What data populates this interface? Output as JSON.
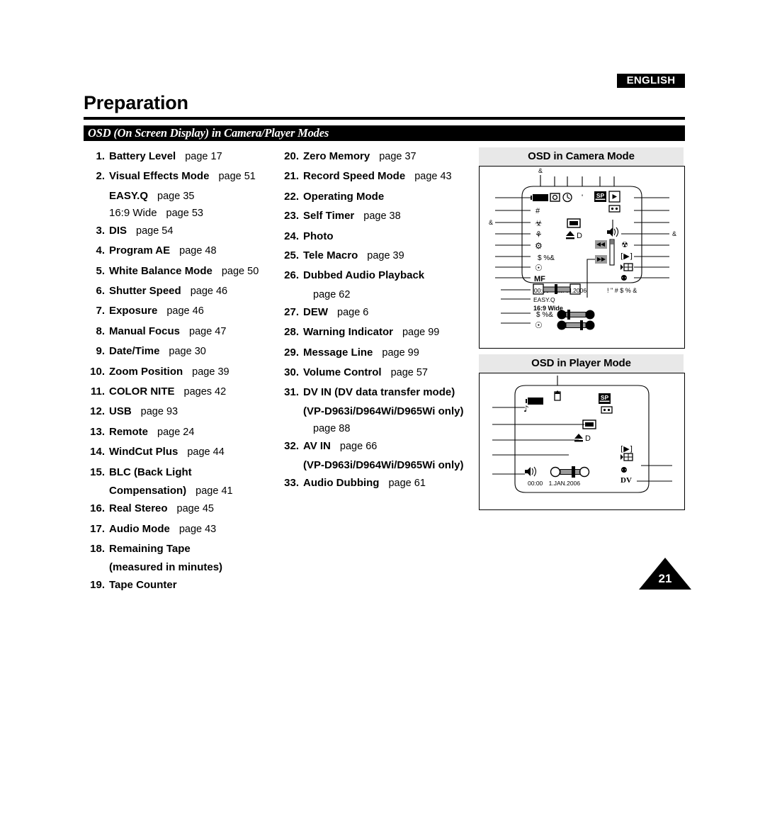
{
  "header": {
    "language_badge": "ENGLISH",
    "chapter_title": "Preparation",
    "section_title": "OSD (On Screen Display) in Camera/Player Modes"
  },
  "page_number": "21",
  "column1": [
    {
      "num": "1.",
      "label": "Battery Level",
      "page": "page 17"
    },
    {
      "num": "2.",
      "label": "Visual Effects Mode",
      "page": "page 51",
      "subs": [
        {
          "label": "EASY.Q",
          "page": "page 35",
          "bold": true
        },
        {
          "label": "16:9 Wide",
          "page": "page 53",
          "bold": false
        }
      ]
    },
    {
      "num": "3.",
      "label": "DIS",
      "page": "page 54"
    },
    {
      "num": "4.",
      "label": "Program AE",
      "page": "page 48"
    },
    {
      "num": "5.",
      "label": "White Balance Mode",
      "page": "page 50"
    },
    {
      "num": "6.",
      "label": "Shutter Speed",
      "page": "page 46"
    },
    {
      "num": "7.",
      "label": "Exposure",
      "page": "page 46"
    },
    {
      "num": "8.",
      "label": "Manual Focus",
      "page": "page 47"
    },
    {
      "num": "9.",
      "label": "Date/Time",
      "page": "page 30"
    },
    {
      "num": "10.",
      "label": "Zoom Position",
      "page": "page 39"
    },
    {
      "num": "11.",
      "label": "COLOR NITE",
      "page": "pages 42"
    },
    {
      "num": "12.",
      "label": "USB",
      "page": "page 93"
    },
    {
      "num": "13.",
      "label": "Remote",
      "page": "page 24"
    },
    {
      "num": "14.",
      "label": "WindCut Plus",
      "page": "page 44"
    },
    {
      "num": "15.",
      "label": "BLC (Back Light",
      "page": "",
      "subs": [
        {
          "label": "Compensation)",
          "page": "page 41",
          "bold": true
        }
      ]
    },
    {
      "num": "16.",
      "label": "Real Stereo",
      "page": "page 45"
    },
    {
      "num": "17.",
      "label": "Audio Mode",
      "page": "page 43"
    },
    {
      "num": "18.",
      "label": "Remaining Tape",
      "page": "",
      "subs": [
        {
          "label": "(measured in minutes)",
          "page": "",
          "bold": true
        }
      ]
    },
    {
      "num": "19.",
      "label": "Tape Counter",
      "page": ""
    }
  ],
  "column2": [
    {
      "num": "20.",
      "label": "Zero Memory",
      "page": "page 37"
    },
    {
      "num": "21.",
      "label": "Record Speed Mode",
      "page": "page 43"
    },
    {
      "num": "22.",
      "label": "Operating Mode",
      "page": ""
    },
    {
      "num": "23.",
      "label": "Self Timer",
      "page": "page 38"
    },
    {
      "num": "24.",
      "label": "Photo",
      "page": ""
    },
    {
      "num": "25.",
      "label": "Tele Macro",
      "page": "page 39"
    },
    {
      "num": "26.",
      "label": "Dubbed Audio Playback",
      "page": "",
      "subs2": [
        {
          "label": "",
          "page": "page 62"
        }
      ]
    },
    {
      "num": "27.",
      "label": "DEW",
      "page": "page 6"
    },
    {
      "num": "28.",
      "label": "Warning Indicator",
      "page": "page 99"
    },
    {
      "num": "29.",
      "label": "Message Line",
      "page": "page 99"
    },
    {
      "num": "30.",
      "label": "Volume Control",
      "page": "page 57"
    },
    {
      "num": "31.",
      "label": "DV IN (DV data transfer mode)",
      "page": "",
      "subs": [
        {
          "label": "(VP-D963i/D964Wi/D965Wi only)",
          "page": "",
          "bold": true
        }
      ],
      "subs2": [
        {
          "label": "",
          "page": "page 88"
        }
      ]
    },
    {
      "num": "32.",
      "label": "AV IN",
      "page": "page 66",
      "subs": [
        {
          "label": "(VP-D963i/D964Wi/D965Wi only)",
          "page": "",
          "bold": true
        }
      ]
    },
    {
      "num": "33.",
      "label": "Audio Dubbing",
      "page": "page 61"
    }
  ],
  "panels": {
    "camera": {
      "title": "OSD in Camera Mode",
      "timecode": "00:00",
      "date": "1.JAN.2006",
      "speed_badge": "SP",
      "easyq": "EASY.Q",
      "wide": "16:9 Wide",
      "dv_marker": "D",
      "warning_glyphs": "! \" #  $ %  &",
      "icons": [
        "battery-icon",
        "tele-macro-icon",
        "photo-icon",
        "self-timer-icon",
        "dis-icon",
        "program-ae-icon",
        "white-balance-icon",
        "shutter-speed-icon",
        "exposure-icon",
        "manual-focus-icon",
        "record-mode-icon",
        "play-icon",
        "tape-icon",
        "volume-icon",
        "rewind-icon",
        "fast-forward-icon",
        "zoom-bar-icon",
        "windcut-icon",
        "blc-icon",
        "real-stereo-icon",
        "audio-mode-icon",
        "colornite-icon",
        "usb-icon",
        "remote-icon"
      ]
    },
    "player": {
      "title": "OSD in Player Mode",
      "timecode": "00:00",
      "date": "1.JAN.2006",
      "speed_badge": "SP",
      "dv_marker": "D",
      "dv_badge": "DV",
      "icons": [
        "battery-icon",
        "zero-memory-icon",
        "record-mode-icon",
        "tape-icon",
        "audio-dubbing-icon",
        "photo-icon",
        "dv-in-icon",
        "volume-icon",
        "tape-position-icon",
        "warning-icon",
        "message-icon",
        "av-in-icon"
      ]
    }
  }
}
